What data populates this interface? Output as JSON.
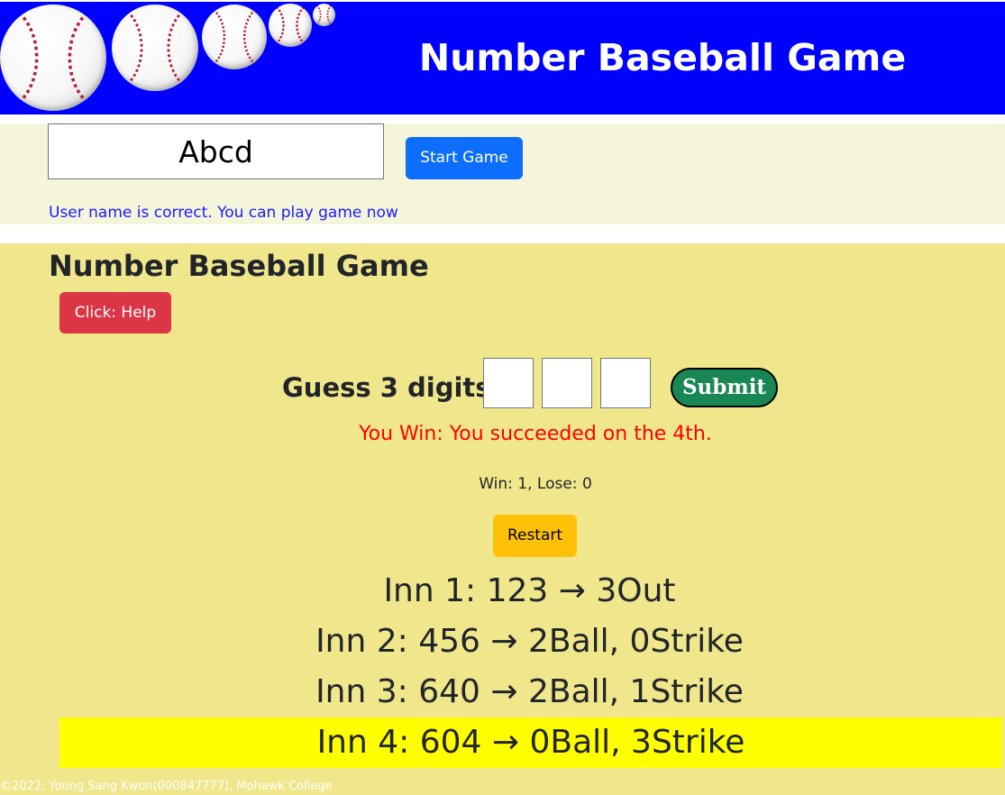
{
  "header": {
    "title": "Number Baseball Game",
    "balls": [
      "baseball-icon",
      "baseball-icon",
      "baseball-icon",
      "baseball-icon",
      "baseball-icon"
    ]
  },
  "user": {
    "name_value": "Abcd",
    "start_label": "Start Game",
    "message": "User name is correct. You can play game now"
  },
  "game": {
    "title": "Number Baseball Game",
    "help_label": "Click: Help",
    "guess_label": "Guess 3 digits:",
    "digits": [
      "",
      "",
      ""
    ],
    "submit_label": "Submit",
    "result_message": "You Win: You succeeded on the 4th.",
    "score": "Win: 1, Lose: 0",
    "restart_label": "Restart",
    "innings": [
      "Inn 1: 123 → 3Out",
      "Inn 2: 456 → 2Ball, 0Strike",
      "Inn 3: 640 → 2Ball, 1Strike",
      "Inn 4: 604 → 0Ball, 3Strike"
    ]
  },
  "footer": {
    "text": "©2022, Young Sang Kwon(000847777), Mohawk College"
  },
  "colors": {
    "header_bg": "#0000ff",
    "user_panel_bg": "#f5f5dc",
    "game_panel_bg": "#f0e68c",
    "highlight": "#ffff00",
    "win_text": "#ff0000",
    "user_msg_text": "#1a1aff"
  }
}
